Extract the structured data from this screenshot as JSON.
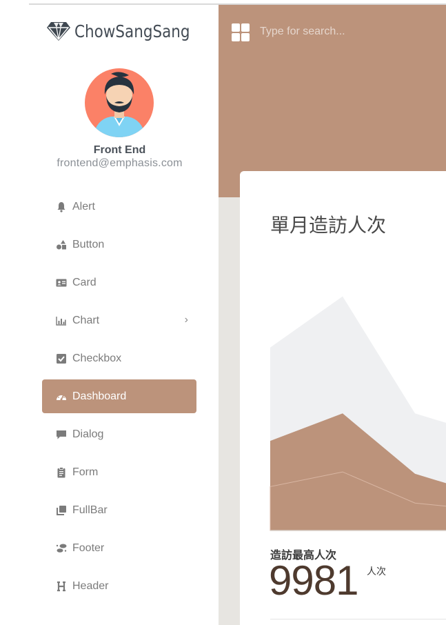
{
  "brand": {
    "name": "ChowSangSang",
    "logo_icon": "diamond-icon"
  },
  "profile": {
    "name": "Front End",
    "email": "frontend@emphasis.com",
    "avatar_icon": "bearded-man-avatar"
  },
  "search": {
    "placeholder": "Type for search..."
  },
  "menu": [
    {
      "label": "Alert",
      "icon": "bell-icon"
    },
    {
      "label": "Button",
      "icon": "shapes-icon"
    },
    {
      "label": "Card",
      "icon": "id-card-icon"
    },
    {
      "label": "Chart",
      "icon": "bar-chart-icon",
      "has_children": true
    },
    {
      "label": "Checkbox",
      "icon": "checkbox-icon"
    },
    {
      "label": "Dashboard",
      "icon": "speedometer-icon",
      "active": true
    },
    {
      "label": "Dialog",
      "icon": "chat-bubble-icon"
    },
    {
      "label": "Form",
      "icon": "clipboard-icon"
    },
    {
      "label": "FullBar",
      "icon": "copy-icon"
    },
    {
      "label": "Footer",
      "icon": "footprints-icon"
    },
    {
      "label": "Header",
      "icon": "heading-icon"
    }
  ],
  "card": {
    "title": "單月造訪人次",
    "stat_label": "造訪最高人次",
    "stat_value": "9981",
    "stat_unit": "人次"
  },
  "colors": {
    "accent": "#bc937b",
    "page_bg": "#e7e5e1",
    "area_light": "#eff0f2",
    "area_dark": "#bc937b",
    "stat_value": "#4e3a2e"
  },
  "chart_data": {
    "type": "area",
    "title": "",
    "series": [
      {
        "values": [
          1.0,
          1.28,
          0.64,
          0.52
        ]
      },
      {
        "values": [
          0.49,
          0.64,
          0.31,
          0.19
        ]
      },
      {
        "values": [
          0.24,
          0.32,
          0.15,
          0.11
        ]
      }
    ],
    "ylim": [
      0,
      1.35
    ],
    "grid": false,
    "legend": "none"
  }
}
